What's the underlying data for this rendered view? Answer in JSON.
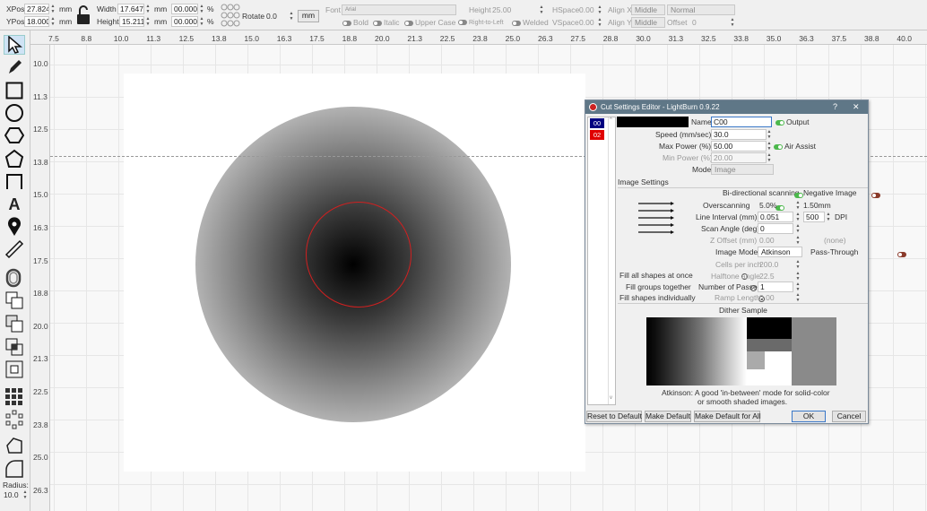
{
  "toolbar": {
    "xpos_label": "XPos",
    "xpos_value": "27.824",
    "xpos_unit": "mm",
    "ypos_label": "YPos",
    "ypos_value": "18.000",
    "ypos_unit": "mm",
    "width_label": "Width",
    "width_value": "17.647",
    "width_unit": "mm",
    "height_label": "Height",
    "height_value": "15.211",
    "height_unit": "mm",
    "scale_w": "00.000",
    "scale_h": "00.000",
    "percent": "%",
    "rotate_label": "Rotate",
    "rotate_value": "0.0",
    "mm_button": "mm",
    "font_label": "Font",
    "font_value": "Arial",
    "bold": "Bold",
    "italic": "Italic",
    "upper_case": "Upper Case",
    "rtl": "Right-to-Left",
    "welded": "Welded",
    "text_height_label": "Height",
    "text_height_value": "25.00",
    "hspace_label": "HSpace",
    "hspace_value": "0.00",
    "vspace_label": "VSpace",
    "vspace_value": "0.00",
    "align_x_label": "Align X",
    "align_x_value": "Middle",
    "align_y_label": "Align Y",
    "align_y_value": "Middle",
    "normal_value": "Normal",
    "offset_label": "Offset",
    "offset_value": "0"
  },
  "ruler_top": [
    "7.5",
    "8.8",
    "10.0",
    "11.3",
    "12.5",
    "13.8",
    "15.0",
    "16.3",
    "17.5",
    "18.8",
    "20.0",
    "21.3",
    "22.5",
    "23.8",
    "25.0",
    "26.3",
    "27.5",
    "28.8",
    "30.0",
    "31.3",
    "32.5",
    "33.8",
    "35.0",
    "36.3",
    "37.5",
    "38.8",
    "40.0"
  ],
  "ruler_left": [
    "10.0",
    "11.3",
    "12.5",
    "13.8",
    "15.0",
    "16.3",
    "17.5",
    "18.8",
    "20.0",
    "21.3",
    "22.5",
    "23.8",
    "25.0",
    "26.3"
  ],
  "tools": [
    "select-icon",
    "pencil-icon",
    "rectangle-icon",
    "ellipse-icon",
    "polygon-icon",
    "pentagon-icon",
    "bracket-icon",
    "text-icon",
    "location-pin-icon",
    "measure-icon",
    "offset-icon",
    "boolean-union-icon",
    "boolean-subtract-icon",
    "boolean-intersect-icon",
    "weld-icon",
    "grid-array-icon",
    "circular-array-icon",
    "node-edit-icon",
    "corner-icon"
  ],
  "radius_label": "Radius:",
  "radius_value": "10.0",
  "dialog": {
    "title": "Cut Settings Editor - LightBurn 0.9.22",
    "help": "?",
    "close": "✕",
    "layers": [
      {
        "label": "00",
        "color": "#000080"
      },
      {
        "label": "02",
        "color": "#e00000"
      }
    ],
    "name_label": "Name",
    "name_value": "C00",
    "output_label": "Output",
    "speed_label": "Speed (mm/sec)",
    "speed_value": "30.0",
    "max_power_label": "Max Power (%)",
    "max_power_value": "50.00",
    "air_assist_label": "Air Assist",
    "min_power_label": "Min Power (%)",
    "min_power_value": "20.00",
    "mode_label": "Mode",
    "mode_value": "Image",
    "image_settings_label": "Image Settings",
    "bidir_label": "Bi-directional scanning",
    "negative_label": "Negative Image",
    "overscan_label": "Overscanning",
    "overscan_value": "5.0%",
    "overscan_mm": "1.50mm",
    "line_interval_label": "Line Interval (mm)",
    "line_interval_value": "0.051",
    "dpi_value": "500",
    "dpi_label": "DPI",
    "scan_angle_label": "Scan Angle (deg)",
    "scan_angle_value": "0",
    "z_offset_label": "Z Offset (mm)",
    "z_offset_value": "0.00",
    "z_offset_none": "(none)",
    "image_mode_label": "Image Mode",
    "image_mode_value": "Atkinson",
    "pass_through_label": "Pass-Through",
    "cells_label": "Cells per inch",
    "cells_value": "200.0",
    "halftone_label": "Halftone angle",
    "halftone_value": "22.5",
    "passes_label": "Number of Passes",
    "passes_value": "1",
    "ramp_label": "Ramp Length",
    "ramp_value": "0.00",
    "fill_all_label": "Fill all shapes at once",
    "fill_groups_label": "Fill groups together",
    "fill_indiv_label": "Fill shapes individually",
    "dither_label": "Dither Sample",
    "dither_desc1": "Atkinson: A good 'in-between' mode for solid-color",
    "dither_desc2": "or smooth shaded images.",
    "reset_button": "Reset to Default",
    "make_default_button": "Make Default",
    "make_default_all_button": "Make Default for All",
    "ok_button": "OK",
    "cancel_button": "Cancel"
  }
}
